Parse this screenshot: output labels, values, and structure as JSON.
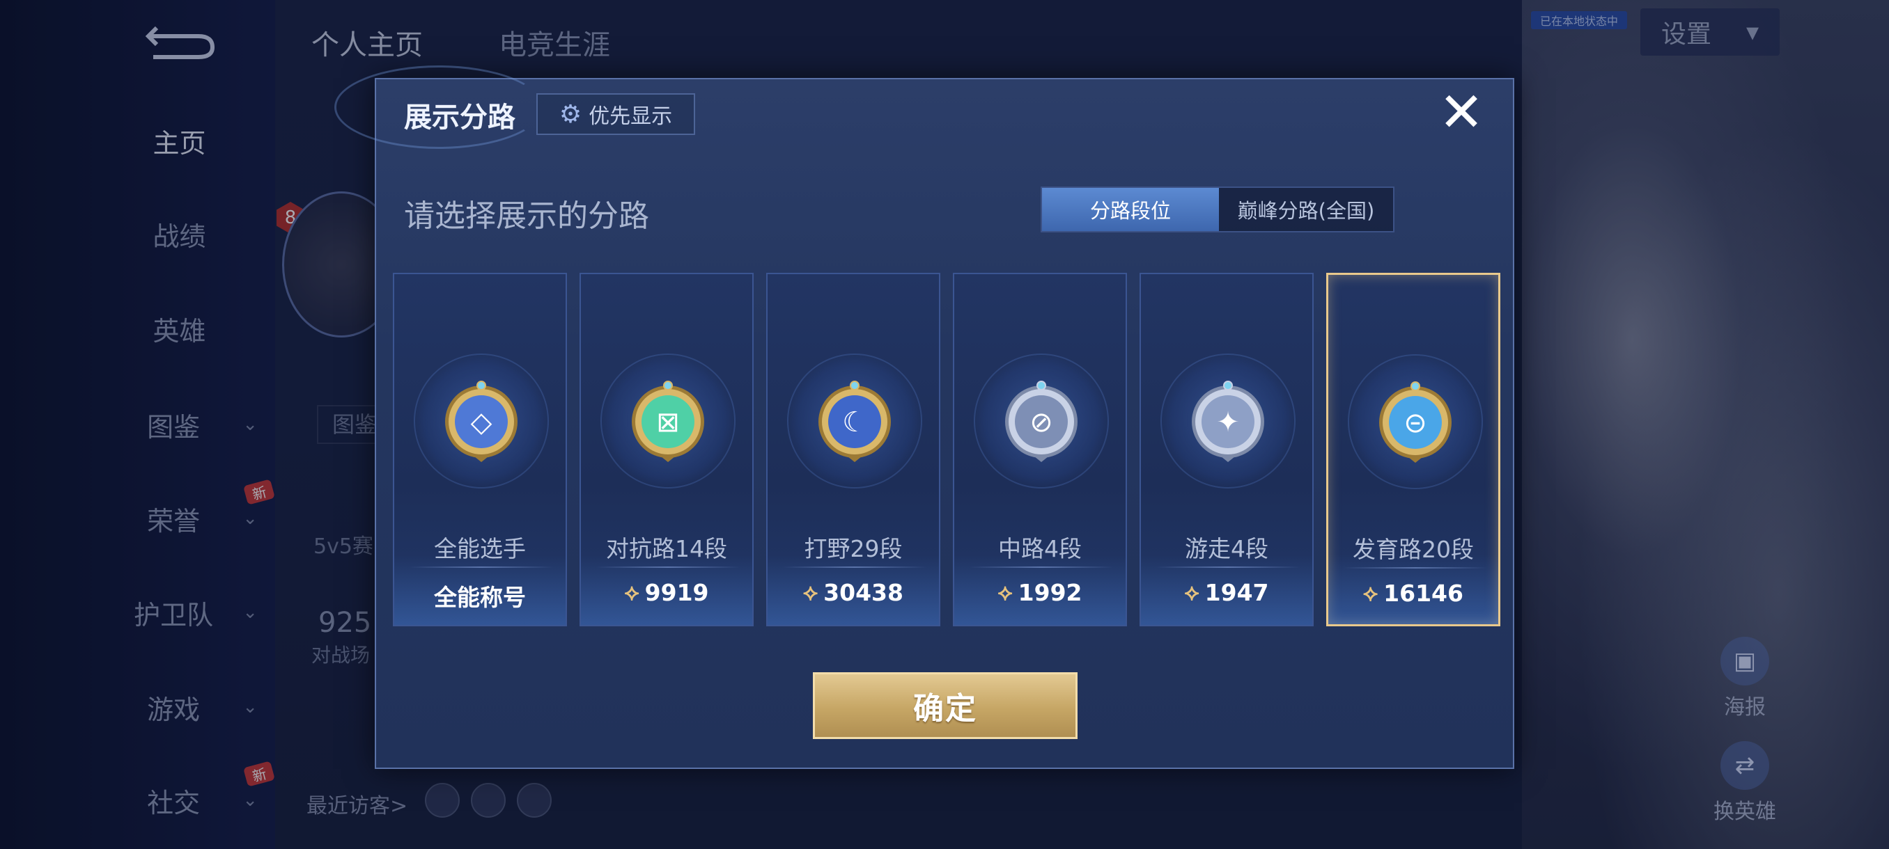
{
  "sidebar": {
    "items": [
      {
        "label": "主页",
        "chevron": false,
        "new": false
      },
      {
        "label": "战绩",
        "chevron": false,
        "new": false
      },
      {
        "label": "英雄",
        "chevron": false,
        "new": false
      },
      {
        "label": "图鉴",
        "chevron": true,
        "new": false
      },
      {
        "label": "荣誉",
        "chevron": true,
        "new": true
      },
      {
        "label": "护卫队",
        "chevron": true,
        "new": false
      },
      {
        "label": "游戏",
        "chevron": true,
        "new": false
      },
      {
        "label": "社交",
        "chevron": true,
        "new": true
      }
    ],
    "new_badge": "新"
  },
  "header": {
    "tabs": [
      "个人主页",
      "电竞生涯"
    ],
    "settings_label": "设置",
    "tag": "已在本地状态中"
  },
  "background": {
    "catalog_placeholder": "图鉴系",
    "rank_text": "5v5赛",
    "score": "925",
    "score_label": "对战场",
    "level": "8",
    "visitors_label": "最近访客>"
  },
  "side_actions": [
    {
      "label": "海报",
      "icon": "poster-icon"
    },
    {
      "label": "换英雄",
      "icon": "swap-hero-icon"
    }
  ],
  "modal": {
    "title": "展示分路",
    "priority_label": "优先显示",
    "subtitle": "请选择展示的分路",
    "toggle": {
      "active": "分路段位",
      "inactive": "巅峰分路(全国)"
    },
    "confirm_label": "确定",
    "cards": [
      {
        "role": "全能选手",
        "value": "全能称号",
        "has_rank_icon": false,
        "badge_color": "#4f79d6",
        "selected": false
      },
      {
        "role": "对抗路14段",
        "value": "9919",
        "has_rank_icon": true,
        "badge_color": "#4fd0a6",
        "selected": false
      },
      {
        "role": "打野29段",
        "value": "30438",
        "has_rank_icon": true,
        "badge_color": "#3f67c9",
        "selected": false
      },
      {
        "role": "中路4段",
        "value": "1992",
        "has_rank_icon": true,
        "badge_color": "#7e8fb5",
        "selected": false
      },
      {
        "role": "游走4段",
        "value": "1947",
        "has_rank_icon": true,
        "badge_color": "#8ea0c6",
        "selected": false
      },
      {
        "role": "发育路20段",
        "value": "16146",
        "has_rank_icon": true,
        "badge_color": "#4aa6e8",
        "selected": true
      }
    ]
  },
  "colors": {
    "accent_gold": "#e9c98c",
    "toggle_active": "#4a76bf",
    "modal_bg": "#26385f"
  }
}
